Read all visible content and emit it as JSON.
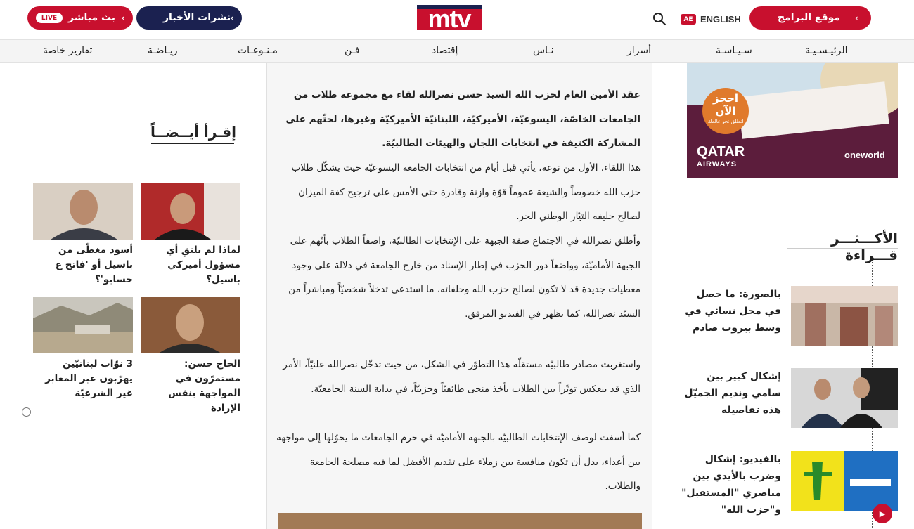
{
  "header": {
    "live_badge": "LIVE",
    "live_label": "بث مباشر",
    "news_label": "نشرات الأخبار",
    "programs_label": "موقع البرامج",
    "logo_text": "mtv",
    "lang_badge": "AE",
    "lang_label": "ENGLISH",
    "arrow": "‹"
  },
  "nav": {
    "items": [
      "الرئيـسـيـة",
      "سـيـاسـة",
      "أسرار",
      "نـاس",
      "إقتصاد",
      "فـن",
      "مـنـوعـات",
      "ريـاضـة",
      "تقارير خاصة"
    ]
  },
  "article": {
    "paragraphs": [
      "عقد الأمين العام لحزب الله السيد حسن نصرالله لقاء مع مجموعة طلاب من الجامعات الخاصّة، اليسوعيّة، الأميركيّة، اللبنانيّة الأميركيّة وغيرها، لحثّهم على المشاركة الكثيفة في انتخابات اللجان والهيئات الطالبيّة.",
      "هذا اللقاء، الأول من نوعه، يأتي قبل أيام من انتخابات الجامعة اليسوعيّة حيث يشكّل طلاب حزب الله خصوصاً والشيعة عموماً قوّة وازنة وقادرة حتى الأمس على ترجيح كفة الميزان لصالح حليفه التيّار الوطني الحر.",
      "وأطلق نصرالله في الاجتماع صفة الجبهة على الإنتخابات الطالبيّة، واصفاً الطلاب بأنّهم على الجبهة الأماميّة، وواضعاً دور الحزب في إطار الإسناد من خارج الجامعة في دلالة على وجود معطيات جديدة قد لا تكون لصالح حزب الله وحلفائه، ما استدعى تدخلاً شخصيّاً ومباشراً من السيّد نصرالله، كما يظهر في الفيديو المرفق.",
      "واستغربت مصادر طالبيّة مستقلّة هذا التطوّر في الشكل، من حيث تدخّل نصرالله علنيّاً، الأمر الذي قد ينعكس توتّراً بين الطلاب يأخذ منحى طائفيّاً وحزبيّاً، في بداية السنة الجامعيّة.",
      "كما أسفت لوصف الإنتخابات الطالبيّة بالجبهة الأماميّة في حرم الجامعات ما يحوّلها إلى مواجهة بين أعداء، بدل أن تكون منافسة بين زملاء على تقديم الأفضل لما فيه مصلحة الجامعة والطلاب."
    ]
  },
  "read_also": {
    "title": "إقـرأ أيــضــاً",
    "cards": [
      {
        "caption": "لماذا لم يلتقِ أي مسؤول أميركي باسيل؟"
      },
      {
        "caption": "أسود مغطّى من باسيل أو 'فاتح ع حسابو'؟"
      },
      {
        "caption": "الحاج حسن: مستمرّون في المواجهة بنفس الإرادة"
      },
      {
        "caption": "3 نوّاب لبنانيّين يهرّبون عبر المعابر غير الشرعيّة"
      }
    ]
  },
  "ad": {
    "circle_main": "احجز الآن",
    "circle_sub": "انطلق نحو عالمك",
    "brand_name": "QATAR",
    "brand_sub": "AIRWAYS",
    "alliance": "oneworld"
  },
  "most_read": {
    "title": "الأكـــثـــر قـــراءة",
    "items": [
      {
        "caption": "بالصورة: ما حصل في محل نسائي في وسط بيروت صادم"
      },
      {
        "caption": "إشكال كبير بين سامي ونديم الجميّل هذه تفاصيله"
      },
      {
        "caption": "بالفيديو: إشكال وضرب بالأيدي بين مناصري \"المستقبل\" و\"حزب الله\""
      }
    ]
  },
  "icons": {
    "play": "▶"
  }
}
